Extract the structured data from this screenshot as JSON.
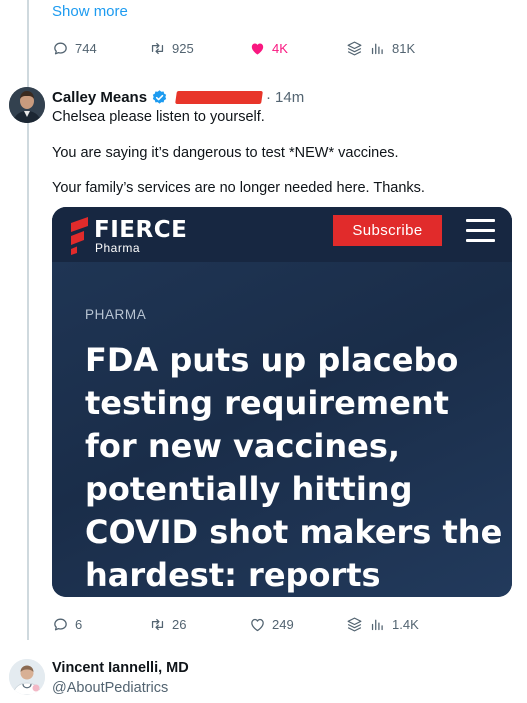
{
  "previous_tweet": {
    "show_more_label": "Show more",
    "actions": {
      "replies": "744",
      "reposts": "925",
      "likes": "4K",
      "views": "81K"
    }
  },
  "tweet": {
    "author_name": "Calley Means",
    "separator": "·",
    "time": "14m",
    "text_lines": [
      "Chelsea please listen to yourself.",
      "You are saying it’s dangerous to test *NEW* vaccines.",
      "Your family’s services are no longer needed here. Thanks."
    ],
    "card": {
      "brand_name": "FIERCE",
      "brand_sub": "Pharma",
      "subscribe_label": "Subscribe",
      "category": "PHARMA",
      "headline": "FDA puts up placebo testing requirement for new vaccines, potentially hitting COVID shot makers the hardest: reports"
    },
    "actions": {
      "replies": "6",
      "reposts": "26",
      "likes": "249",
      "views": "1.4K"
    }
  },
  "next_tweet": {
    "author_name": "Vincent Iannelli, MD",
    "handle": "@AboutPediatrics"
  },
  "colors": {
    "accent": "#1d9bf0",
    "liked": "#f91880",
    "muted": "#536471",
    "card_background": "#1b2f4b",
    "subscribe": "#e12b2b",
    "redaction": "#e8352a"
  },
  "icons": [
    "reply-icon",
    "repost-icon",
    "like-icon",
    "views-icon",
    "verified-icon",
    "menu-icon"
  ]
}
